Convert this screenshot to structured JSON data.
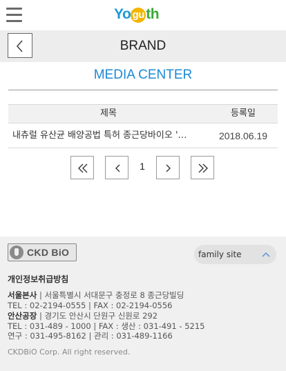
{
  "header": {
    "logo": {
      "part1": "Yo",
      "part2": "gu",
      "part3": "th"
    }
  },
  "brand_bar": {
    "title": "BRAND"
  },
  "section": {
    "title": "MEDIA CENTER"
  },
  "board": {
    "columns": [
      "제목",
      "등록일"
    ],
    "rows": [
      {
        "title": "내츄럴 유산균 배양공법 특허 종근당바이오 '…",
        "date": "2018.06.19"
      }
    ]
  },
  "pagination": {
    "current": "1"
  },
  "footer": {
    "logo_text": "CKD BiO",
    "family_site": "family site",
    "privacy": "개인정보취급방침",
    "seoul": {
      "name": "서울본사",
      "addr": " | 서울특별시 서대문구 충정로 8 종근당빌딩",
      "tel": "TEL : 02-2194-0555 | FAX : 02-2194-0556"
    },
    "ansan": {
      "name": "안산공장",
      "addr": " | 경기도 안산시 단원구 신원로 292",
      "tel": "TEL : 031-489 - 1000 | FAX : 생산 : 031-491 - 5215",
      "tel2": "연구 : 031-495-8162 | 관리 : 031-489-1166"
    },
    "copyright": "CKDBiO Corp. All right reserved."
  }
}
